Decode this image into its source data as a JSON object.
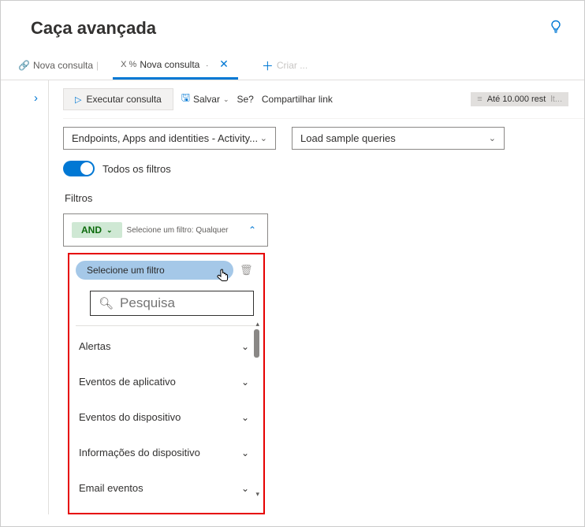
{
  "header": {
    "title": "Caça avançada"
  },
  "tabs": {
    "first": "Nova consulta",
    "active_prefix": "X %",
    "active": "Nova consulta",
    "create": "Criar ..."
  },
  "toolbar": {
    "run": "Executar consulta",
    "save": "Salvar",
    "q": "Se?",
    "share": "Compartilhar link",
    "results": "Até 10.000 rest",
    "results_suffix": "lt..."
  },
  "dropdowns": {
    "scope": "Endpoints, Apps and identities - Activity...",
    "samples": "Load sample queries"
  },
  "filters": {
    "toggle_label": "Todos os filtros",
    "section_label": "Filtros",
    "operator": "AND",
    "hint": "Selecione um filtro: Qualquer",
    "select_label": "Selecione um filtro",
    "search_placeholder": "Pesquisa",
    "categories": [
      "Alertas",
      "Eventos de aplicativo",
      "Eventos do dispositivo",
      "Informações do dispositivo",
      "Email eventos"
    ]
  }
}
